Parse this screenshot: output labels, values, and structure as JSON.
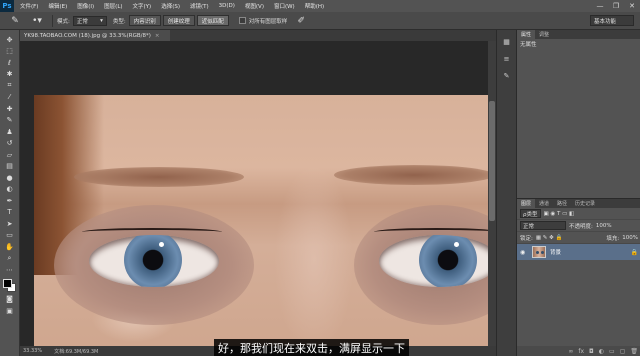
{
  "app": {
    "logo": "Ps",
    "workspace": "基本功能"
  },
  "menu": [
    "文件(F)",
    "编辑(E)",
    "图像(I)",
    "图层(L)",
    "文字(Y)",
    "选择(S)",
    "滤镜(T)",
    "3D(D)",
    "视图(V)",
    "窗口(W)",
    "帮助(H)"
  ],
  "window_controls": [
    "—",
    "❐",
    "✕"
  ],
  "options": {
    "mode_label": "模式:",
    "mode_value": "正常",
    "type_label": "类型:",
    "type_buttons": [
      "内容识别",
      "创建纹理",
      "近似匹配"
    ],
    "sample_all_label": "对所有图层取样"
  },
  "document": {
    "tab_title": "YK98.TAOBAO.COM (18).jpg @ 33.3%(RGB/8*)",
    "close": "×"
  },
  "status": {
    "zoom": "33.33%",
    "doc_info": "文档:69.3M/69.3M"
  },
  "subtitle": "好，那我们现在来双击，满屏显示一下",
  "properties": {
    "tabs": [
      "属性",
      "调整"
    ],
    "title": "无属性"
  },
  "layers": {
    "tabs": [
      "图层",
      "通道",
      "路径",
      "历史记录"
    ],
    "filter_kind": "ρ类型",
    "blend_mode": "正常",
    "opacity_label": "不透明度:",
    "opacity_value": "100%",
    "lock_label": "锁定:",
    "fill_label": "填充:",
    "fill_value": "100%",
    "items": [
      {
        "name": "背景"
      }
    ]
  },
  "icons": {
    "tools": [
      "move-icon",
      "marquee-icon",
      "lasso-icon",
      "quick-select-icon",
      "crop-icon",
      "eyedropper-icon",
      "spot-heal-icon",
      "brush-icon",
      "clone-stamp-icon",
      "history-brush-icon",
      "eraser-icon",
      "gradient-icon",
      "blur-icon",
      "dodge-icon",
      "pen-icon",
      "type-icon",
      "path-select-icon",
      "rectangle-icon",
      "hand-icon",
      "zoom-icon"
    ]
  }
}
